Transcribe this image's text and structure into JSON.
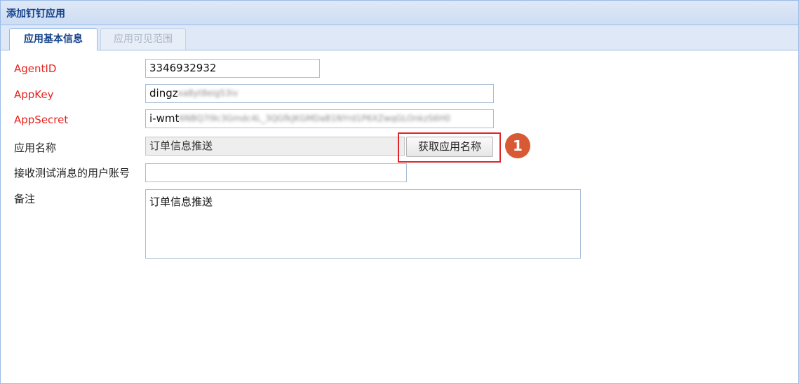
{
  "window": {
    "title": "添加钉钉应用"
  },
  "tabs": [
    {
      "label": "应用基本信息",
      "active": true
    },
    {
      "label": "应用可见范围",
      "active": false
    }
  ],
  "form": {
    "agent_id": {
      "label": "AgentID",
      "value": "3346932932"
    },
    "app_key": {
      "label": "AppKey",
      "value_visible": "dingz",
      "value_obscured": "xa8yt8eig53iv"
    },
    "app_secret": {
      "label": "AppSecret",
      "value_visible": "i-wmt",
      "value_obscured": "6NBQ7I9c3Gmdc4L_3QGfkJKGMDaB1NYrd1P6XZwqGLOnkzS6H0"
    },
    "app_name": {
      "label": "应用名称",
      "value": "订单信息推送",
      "button_label": "获取应用名称"
    },
    "test_user": {
      "label": "接收测试消息的用户账号",
      "value": ""
    },
    "remark": {
      "label": "备注",
      "value": "订单信息推送"
    }
  },
  "annotation": {
    "step_number": "1"
  },
  "colors": {
    "required_label": "#e8221c",
    "highlight_border": "#e0252b",
    "badge": "#d85a35",
    "title_text": "#15428b"
  }
}
